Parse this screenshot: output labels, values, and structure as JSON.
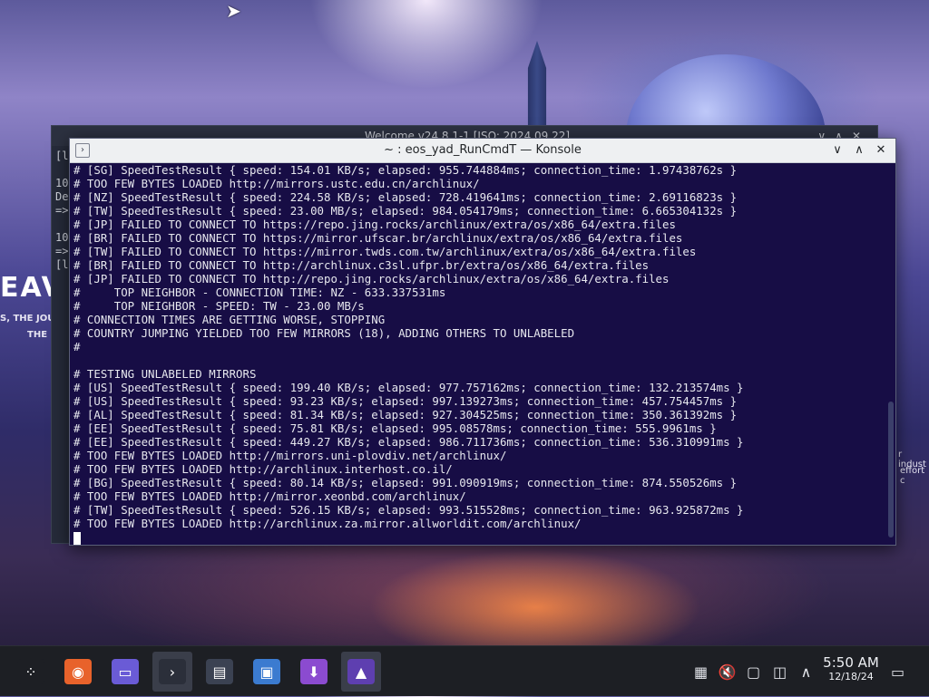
{
  "welcome_window": {
    "title": "Welcome v24.8.1-1 [ISO: 2024.09.22]",
    "left_lines": [
      "[l",
      "",
      "10",
      "De",
      "=>",
      "",
      "10",
      "=>",
      "[l"
    ]
  },
  "desktop_text": {
    "brand": "EAV",
    "sub1": "S, THE JOUR",
    "sub2": "THE F",
    "right1": "r indust",
    "right2": "effort c"
  },
  "konsole": {
    "title": "~ : eos_yad_RunCmdT — Konsole",
    "lines": [
      "# [SG] SpeedTestResult { speed: 154.01 KB/s; elapsed: 955.744884ms; connection_time: 1.97438762s }",
      "# TOO FEW BYTES LOADED http://mirrors.ustc.edu.cn/archlinux/",
      "# [NZ] SpeedTestResult { speed: 224.58 KB/s; elapsed: 728.419641ms; connection_time: 2.69116823s }",
      "# [TW] SpeedTestResult { speed: 23.00 MB/s; elapsed: 984.054179ms; connection_time: 6.665304132s }",
      "# [JP] FAILED TO CONNECT TO https://repo.jing.rocks/archlinux/extra/os/x86_64/extra.files",
      "# [BR] FAILED TO CONNECT TO https://mirror.ufscar.br/archlinux/extra/os/x86_64/extra.files",
      "# [TW] FAILED TO CONNECT TO https://mirror.twds.com.tw/archlinux/extra/os/x86_64/extra.files",
      "# [BR] FAILED TO CONNECT TO http://archlinux.c3sl.ufpr.br/extra/os/x86_64/extra.files",
      "# [JP] FAILED TO CONNECT TO http://repo.jing.rocks/archlinux/extra/os/x86_64/extra.files",
      "#     TOP NEIGHBOR - CONNECTION TIME: NZ - 633.337531ms",
      "#     TOP NEIGHBOR - SPEED: TW - 23.00 MB/s",
      "# CONNECTION TIMES ARE GETTING WORSE, STOPPING",
      "# COUNTRY JUMPING YIELDED TOO FEW MIRRORS (18), ADDING OTHERS TO UNLABELED",
      "#",
      "",
      "# TESTING UNLABELED MIRRORS",
      "# [US] SpeedTestResult { speed: 199.40 KB/s; elapsed: 977.757162ms; connection_time: 132.213574ms }",
      "# [US] SpeedTestResult { speed: 93.23 KB/s; elapsed: 997.139273ms; connection_time: 457.754457ms }",
      "# [AL] SpeedTestResult { speed: 81.34 KB/s; elapsed: 927.304525ms; connection_time: 350.361392ms }",
      "# [EE] SpeedTestResult { speed: 75.81 KB/s; elapsed: 995.08578ms; connection_time: 555.9961ms }",
      "# [EE] SpeedTestResult { speed: 449.27 KB/s; elapsed: 986.711736ms; connection_time: 536.310991ms }",
      "# TOO FEW BYTES LOADED http://mirrors.uni-plovdiv.net/archlinux/",
      "# TOO FEW BYTES LOADED http://archlinux.interhost.co.il/",
      "# [BG] SpeedTestResult { speed: 80.14 KB/s; elapsed: 991.090919ms; connection_time: 874.550526ms }",
      "# TOO FEW BYTES LOADED http://mirror.xeonbd.com/archlinux/",
      "# [TW] SpeedTestResult { speed: 526.15 KB/s; elapsed: 993.515528ms; connection_time: 963.925872ms }",
      "# TOO FEW BYTES LOADED http://archlinux.za.mirror.allworldit.com/archlinux/"
    ]
  },
  "taskbar": {
    "clock_time": "5:50 AM",
    "clock_date": "12/18/24",
    "apps": [
      {
        "icon": "app-launcher-icon",
        "glyph": "⁘"
      },
      {
        "icon": "firefox-icon",
        "glyph": "◉"
      },
      {
        "icon": "file-manager-icon",
        "glyph": "▭"
      },
      {
        "icon": "konsole-icon",
        "glyph": "›"
      },
      {
        "icon": "system-monitor-icon",
        "glyph": "▤"
      },
      {
        "icon": "screenshot-icon",
        "glyph": "▣"
      },
      {
        "icon": "downloader-icon",
        "glyph": "⬇"
      },
      {
        "icon": "endeavouros-welcome-icon",
        "glyph": "▲"
      }
    ],
    "tray": [
      {
        "icon": "keyboard-layout-icon",
        "glyph": "▦"
      },
      {
        "icon": "volume-muted-icon",
        "glyph": "🔇"
      },
      {
        "icon": "save-disk-icon",
        "glyph": "▢"
      },
      {
        "icon": "network-icon",
        "glyph": "◫"
      },
      {
        "icon": "tray-expand-icon",
        "glyph": "∧"
      }
    ],
    "show_desktop_glyph": "▭"
  }
}
